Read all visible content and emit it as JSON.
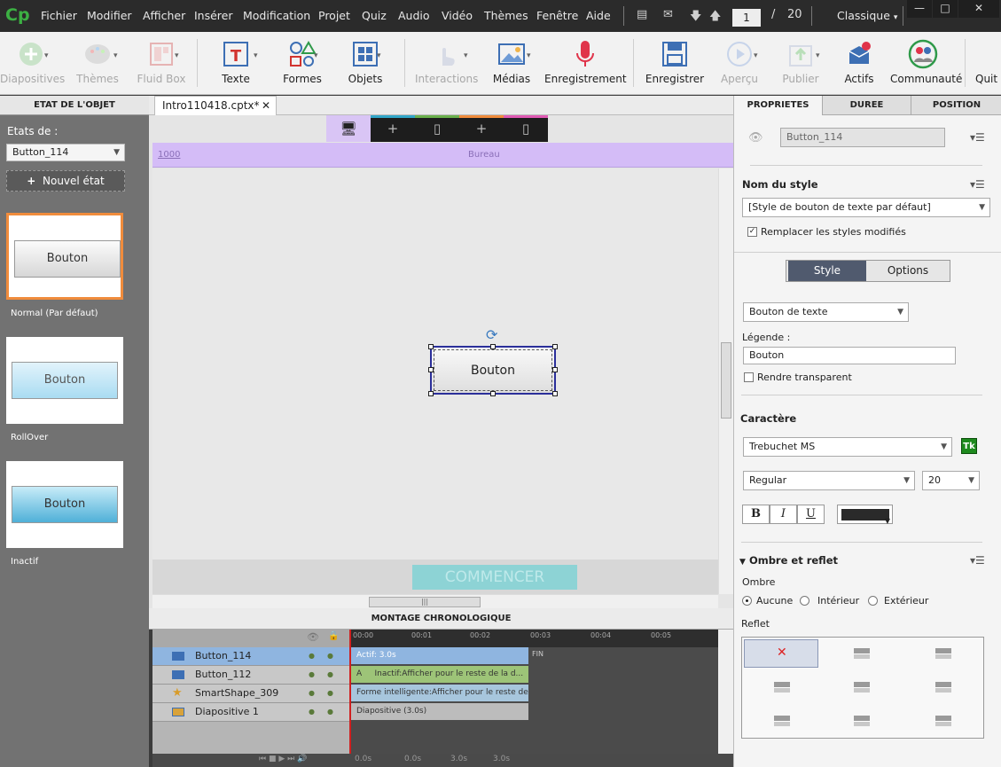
{
  "menubar": {
    "logo": "Cp",
    "items": [
      "Fichier",
      "Modifier",
      "Afficher",
      "Insérer",
      "Modification",
      "Projet",
      "Quiz",
      "Audio",
      "Vidéo",
      "Thèmes",
      "Fenêtre",
      "Aide"
    ],
    "current_page": "1",
    "page_separator": "/",
    "total_pages": "20",
    "workspace": "Classique"
  },
  "toolbar": {
    "items": [
      {
        "label": "Diapositives",
        "icon": "add-slide-icon",
        "disabled": true
      },
      {
        "label": "Thèmes",
        "icon": "palette-icon",
        "disabled": true
      },
      {
        "label": "Fluid Box",
        "icon": "fluid-box-icon",
        "disabled": true
      },
      {
        "label": "Texte",
        "icon": "text-icon",
        "disabled": false
      },
      {
        "label": "Formes",
        "icon": "shapes-icon",
        "disabled": false
      },
      {
        "label": "Objets",
        "icon": "objects-icon",
        "disabled": false
      },
      {
        "label": "Interactions",
        "icon": "hand-pointer-icon",
        "disabled": true
      },
      {
        "label": "Médias",
        "icon": "image-icon",
        "disabled": false
      },
      {
        "label": "Enregistrement",
        "icon": "microphone-icon",
        "disabled": false
      },
      {
        "label": "Enregistrer",
        "icon": "save-icon",
        "disabled": false
      },
      {
        "label": "Aperçu",
        "icon": "play-icon",
        "disabled": true
      },
      {
        "label": "Publier",
        "icon": "publish-icon",
        "disabled": true
      },
      {
        "label": "Actifs",
        "icon": "assets-icon",
        "disabled": false
      },
      {
        "label": "Communauté",
        "icon": "community-icon",
        "disabled": false
      },
      {
        "label": "Quit",
        "icon": "",
        "disabled": false
      }
    ]
  },
  "left_panel": {
    "header": "ETAT DE L'OBJET",
    "etats_label": "Etats de :",
    "selected_object": "Button_114",
    "new_state": "Nouvel état",
    "states": [
      {
        "label": "Normal (Par défaut)",
        "button_text": "Bouton"
      },
      {
        "label": "RollOver",
        "button_text": "Bouton"
      },
      {
        "label": "Inactif",
        "button_text": "Bouton"
      }
    ]
  },
  "document": {
    "tab_name": "Intro110418.cptx*",
    "ruler_left": "1000",
    "ruler_center": "Bureau",
    "button_text": "Bouton",
    "commencer": "COMMENCER"
  },
  "timeline": {
    "header": "MONTAGE CHRONOLOGIQUE",
    "ruler": [
      "00:00",
      "00:01",
      "00:02",
      "00:03",
      "00:04",
      "00:05"
    ],
    "fin": "FIN",
    "layers": [
      {
        "name": "Button_114",
        "bar": "Actif: 3.0s",
        "color": "#8fb5e0"
      },
      {
        "name": "Button_112",
        "bar": "Inactif:Afficher pour le reste de la d...",
        "bar_prefix": "A",
        "color": "#9dc478"
      },
      {
        "name": "SmartShape_309",
        "bar": "Forme intelligente:Afficher pour le reste de...",
        "color": "#a7c6dd"
      },
      {
        "name": "Diapositive 1",
        "bar": "Diapositive (3.0s)",
        "color": "#bcbcbc"
      }
    ],
    "footer": [
      "0.0s",
      "0.0s",
      "3.0s",
      "3.0s"
    ]
  },
  "right_panel": {
    "tabs": [
      "PROPRIETES",
      "DUREE",
      "POSITION"
    ],
    "object_name": "Button_114",
    "style_name_label": "Nom du style",
    "style_value": "[Style de bouton de texte par défaut]",
    "replace_styles": "Remplacer les styles modifiés",
    "seg": [
      "Style",
      "Options"
    ],
    "button_type": "Bouton de texte",
    "legende_label": "Légende :",
    "legende_value": "Bouton",
    "transparent": "Rendre transparent",
    "caractere_label": "Caractère",
    "font": "Trebuchet MS",
    "tk_badge": "Tk",
    "font_style": "Regular",
    "font_size": "20",
    "format_buttons": [
      "B",
      "I",
      "U"
    ],
    "ombre_label": "Ombre et reflet",
    "ombre_sub": "Ombre",
    "ombre_options": [
      "Aucune",
      "Intérieur",
      "Extérieur"
    ],
    "reflet_label": "Reflet"
  },
  "colors": {
    "selected_state_border": "#f08c3c",
    "desktop_view": "#d4bcf7",
    "commencer_button": "#8dd3d5",
    "selection_border": "#2b2f9a",
    "style_tab_active": "#505a6e",
    "tk_green": "#1e8a1e"
  }
}
